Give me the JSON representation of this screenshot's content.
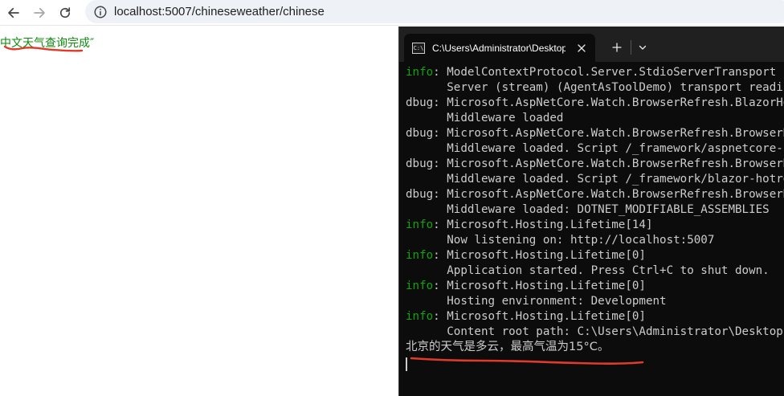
{
  "browser": {
    "url": "localhost:5007/chineseweather/chinese"
  },
  "page": {
    "message": "中文天气查询完成″"
  },
  "terminal": {
    "tab_title": "C:\\Users\\Administrator\\Desktop",
    "log": [
      {
        "level": "info",
        "text": "ModelContextProtocol.Server.StdioServerTransport"
      },
      {
        "level": "",
        "text": "Server (stream) (AgentAsToolDemo) transport reading"
      },
      {
        "level": "dbug",
        "text": "Microsoft.AspNetCore.Watch.BrowserRefresh.BlazorHotReload"
      },
      {
        "level": "",
        "text": "Middleware loaded"
      },
      {
        "level": "dbug",
        "text": "Microsoft.AspNetCore.Watch.BrowserRefresh.BrowserRefresh"
      },
      {
        "level": "",
        "text": "Middleware loaded. Script /_framework/aspnetcore-browser-refresh.js"
      },
      {
        "level": "dbug",
        "text": "Microsoft.AspNetCore.Watch.BrowserRefresh.BrowserRefresh"
      },
      {
        "level": "",
        "text": "Middleware loaded. Script /_framework/blazor-hotreload.js"
      },
      {
        "level": "dbug",
        "text": "Microsoft.AspNetCore.Watch.BrowserRefresh.BrowserRefresh"
      },
      {
        "level": "",
        "text": "Middleware loaded: DOTNET_MODIFIABLE_ASSEMBLIES"
      },
      {
        "level": "info",
        "text": "Microsoft.Hosting.Lifetime[14]"
      },
      {
        "level": "",
        "text": "Now listening on: http://localhost:5007"
      },
      {
        "level": "info",
        "text": "Microsoft.Hosting.Lifetime[0]"
      },
      {
        "level": "",
        "text": "Application started. Press Ctrl+C to shut down."
      },
      {
        "level": "info",
        "text": "Microsoft.Hosting.Lifetime[0]"
      },
      {
        "level": "",
        "text": "Hosting environment: Development"
      },
      {
        "level": "info",
        "text": "Microsoft.Hosting.Lifetime[0]"
      },
      {
        "level": "",
        "text": "Content root path: C:\\Users\\Administrator\\Desktop"
      }
    ],
    "result": "北京的天气是多云，最高气温为15°C。"
  },
  "colors": {
    "info": "#13a10e",
    "page_text": "#0d8a0d",
    "annotation": "#e03a2a"
  },
  "icons": {
    "back": "arrow-left-icon",
    "forward": "arrow-right-icon",
    "reload": "reload-icon",
    "site_info": "site-info-icon",
    "tab": "console-icon",
    "close": "close-icon",
    "new_tab": "plus-icon",
    "dropdown": "chevron-down-icon"
  }
}
